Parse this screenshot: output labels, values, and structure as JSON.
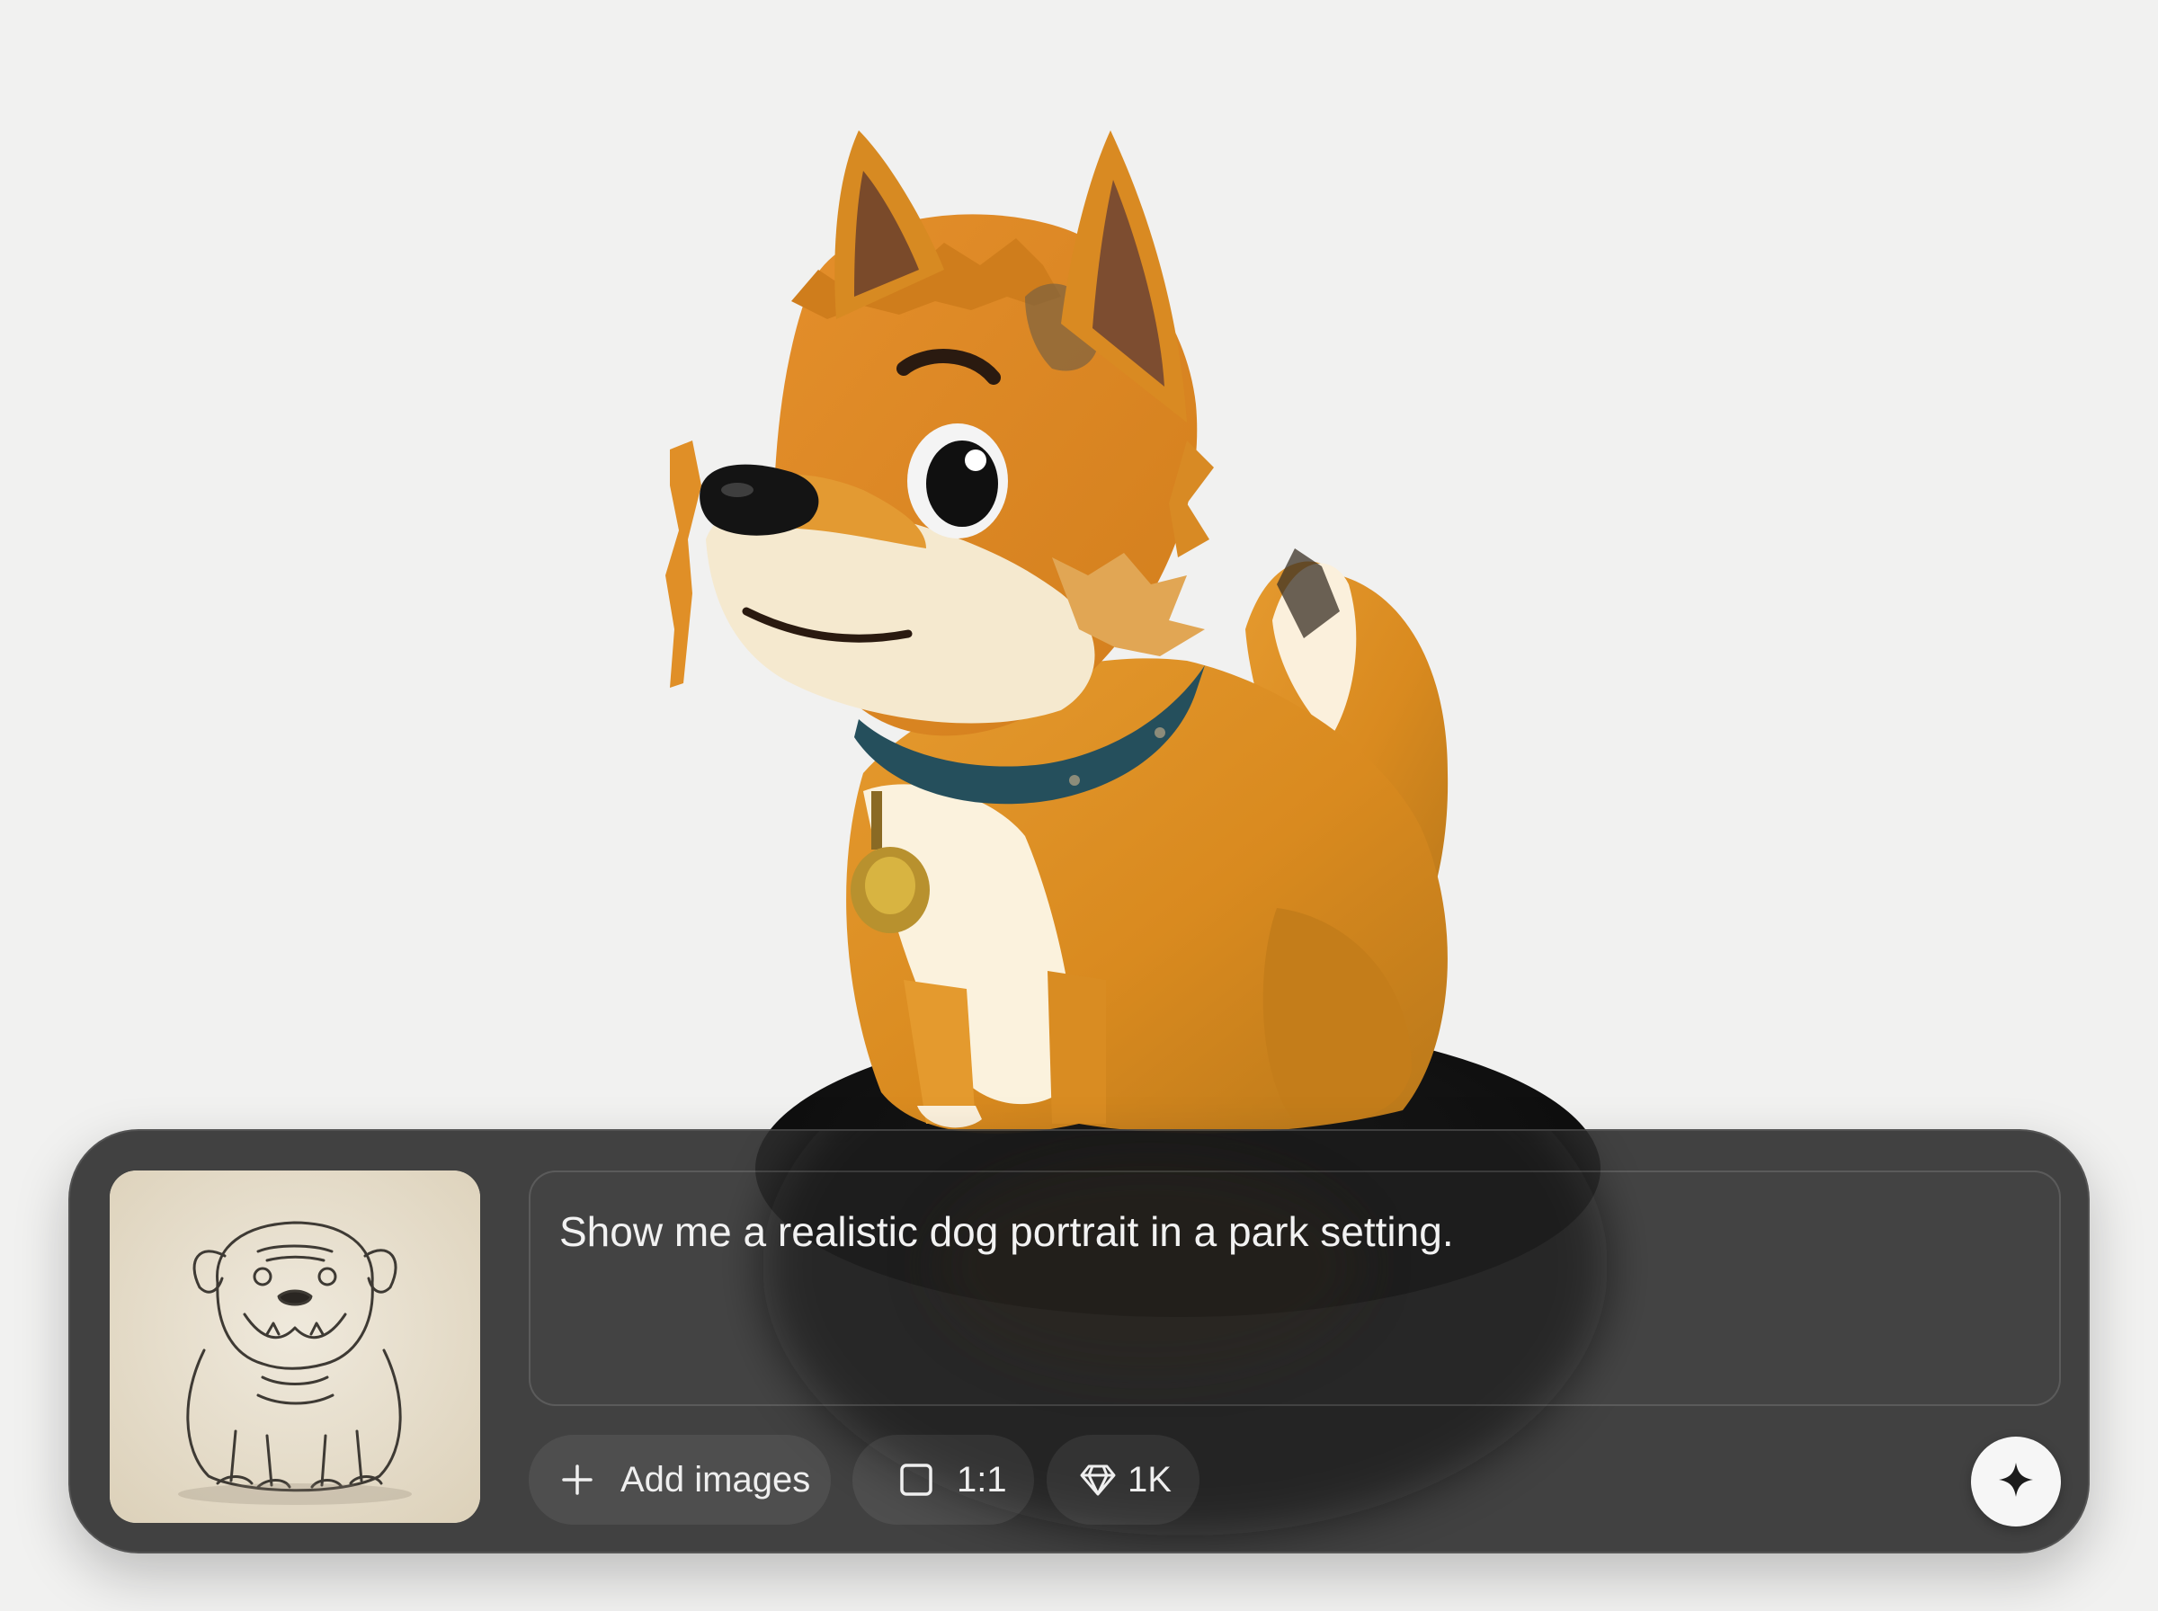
{
  "colors": {
    "background": "#f1f1f0",
    "panel": "#2e2e2e",
    "text": "#f2f2f2",
    "generate_button": "#f6f6f6"
  },
  "scene": {
    "preview_icon": "3d-dog-model-render"
  },
  "composer": {
    "reference_image_icon": "bulldog-sketch-thumbnail",
    "prompt_text": "Show me a realistic dog portrait in a park setting.",
    "add_images_label": "Add images",
    "add_images_icon": "plus-icon",
    "aspect_ratio_label": "1:1",
    "aspect_ratio_icon": "square-icon",
    "resolution_label": "1K",
    "resolution_icon": "diamond-icon",
    "generate_icon": "sparkle-icon"
  }
}
